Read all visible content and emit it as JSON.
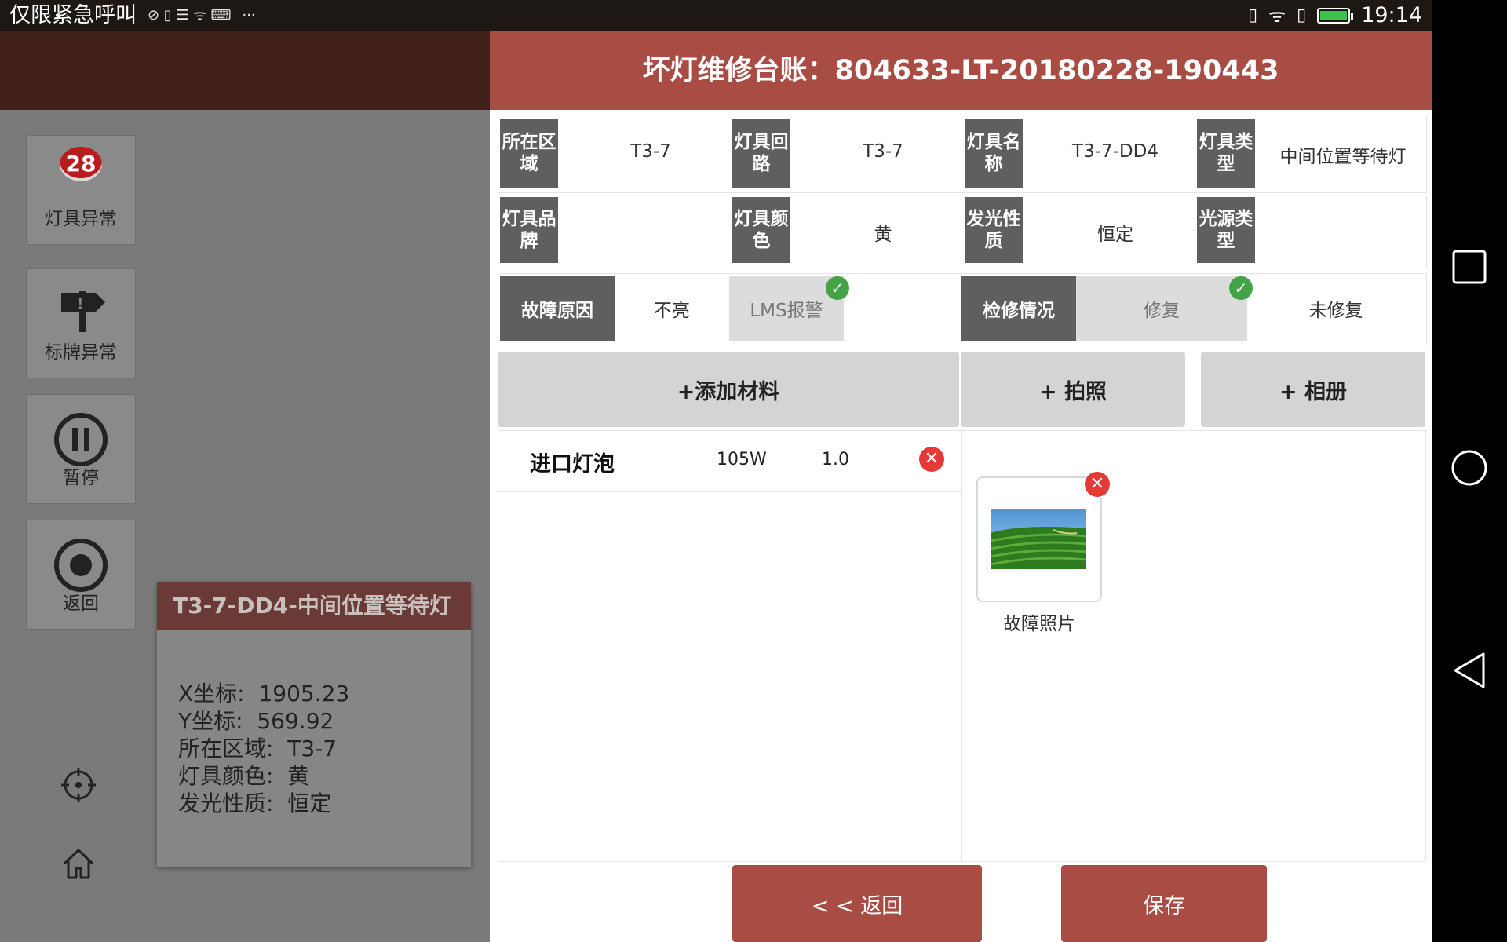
{
  "status_bar": {
    "emergency_text": "仅限紧急呼叫",
    "time": "19:14",
    "more": "···"
  },
  "nav_bar": {
    "icons": [
      "recents-icon",
      "home-circle-icon",
      "back-triangle-icon"
    ]
  },
  "background_app": {
    "sidebar": [
      {
        "label": "灯具异常",
        "badge": "28",
        "icon": "lamp-icon"
      },
      {
        "label": "标牌异常",
        "icon": "sign-icon"
      },
      {
        "label": "暂停",
        "icon": "pause-icon"
      },
      {
        "label": "返回",
        "icon": "stop-icon"
      }
    ],
    "tools": [
      "locate-icon",
      "home-icon"
    ],
    "info_card": {
      "title": "T3-7-DD4-中间位置等待灯",
      "lines": [
        {
          "label": "X坐标:",
          "value": "1905.23"
        },
        {
          "label": "Y坐标:",
          "value": "569.92"
        },
        {
          "label": "所在区域:",
          "value": "T3-7"
        },
        {
          "label": "灯具颜色:",
          "value": "黄"
        },
        {
          "label": "发光性质:",
          "value": "恒定"
        }
      ]
    }
  },
  "modal": {
    "title": "坏灯维修台账：804633-LT-20180228-190443",
    "row1": [
      {
        "label": "所在区域",
        "value": "T3-7"
      },
      {
        "label": "灯具回路",
        "value": "T3-7"
      },
      {
        "label": "灯具名称",
        "value": "T3-7-DD4"
      },
      {
        "label": "灯具类型",
        "value": "中间位置等待灯"
      }
    ],
    "row2": [
      {
        "label": "灯具品牌",
        "value": ""
      },
      {
        "label": "灯具颜色",
        "value": "黄"
      },
      {
        "label": "发光性质",
        "value": "恒定"
      },
      {
        "label": "光源类型",
        "value": ""
      }
    ],
    "fault": {
      "label": "故障原因",
      "options": [
        "不亮",
        "LMS报警"
      ],
      "selected": "LMS报警"
    },
    "repair": {
      "label": "检修情况",
      "options": [
        "修复",
        "未修复"
      ],
      "selected": "修复"
    },
    "buttons": {
      "add_material": "+添加材料",
      "take_photo": "+ 拍照",
      "album": "+ 相册",
      "back": "< < 返回",
      "save": "保存"
    },
    "materials": [
      {
        "name": "进口灯泡",
        "spec": "105W",
        "qty": "1.0"
      }
    ],
    "photos": [
      {
        "caption": "故障照片"
      }
    ]
  }
}
